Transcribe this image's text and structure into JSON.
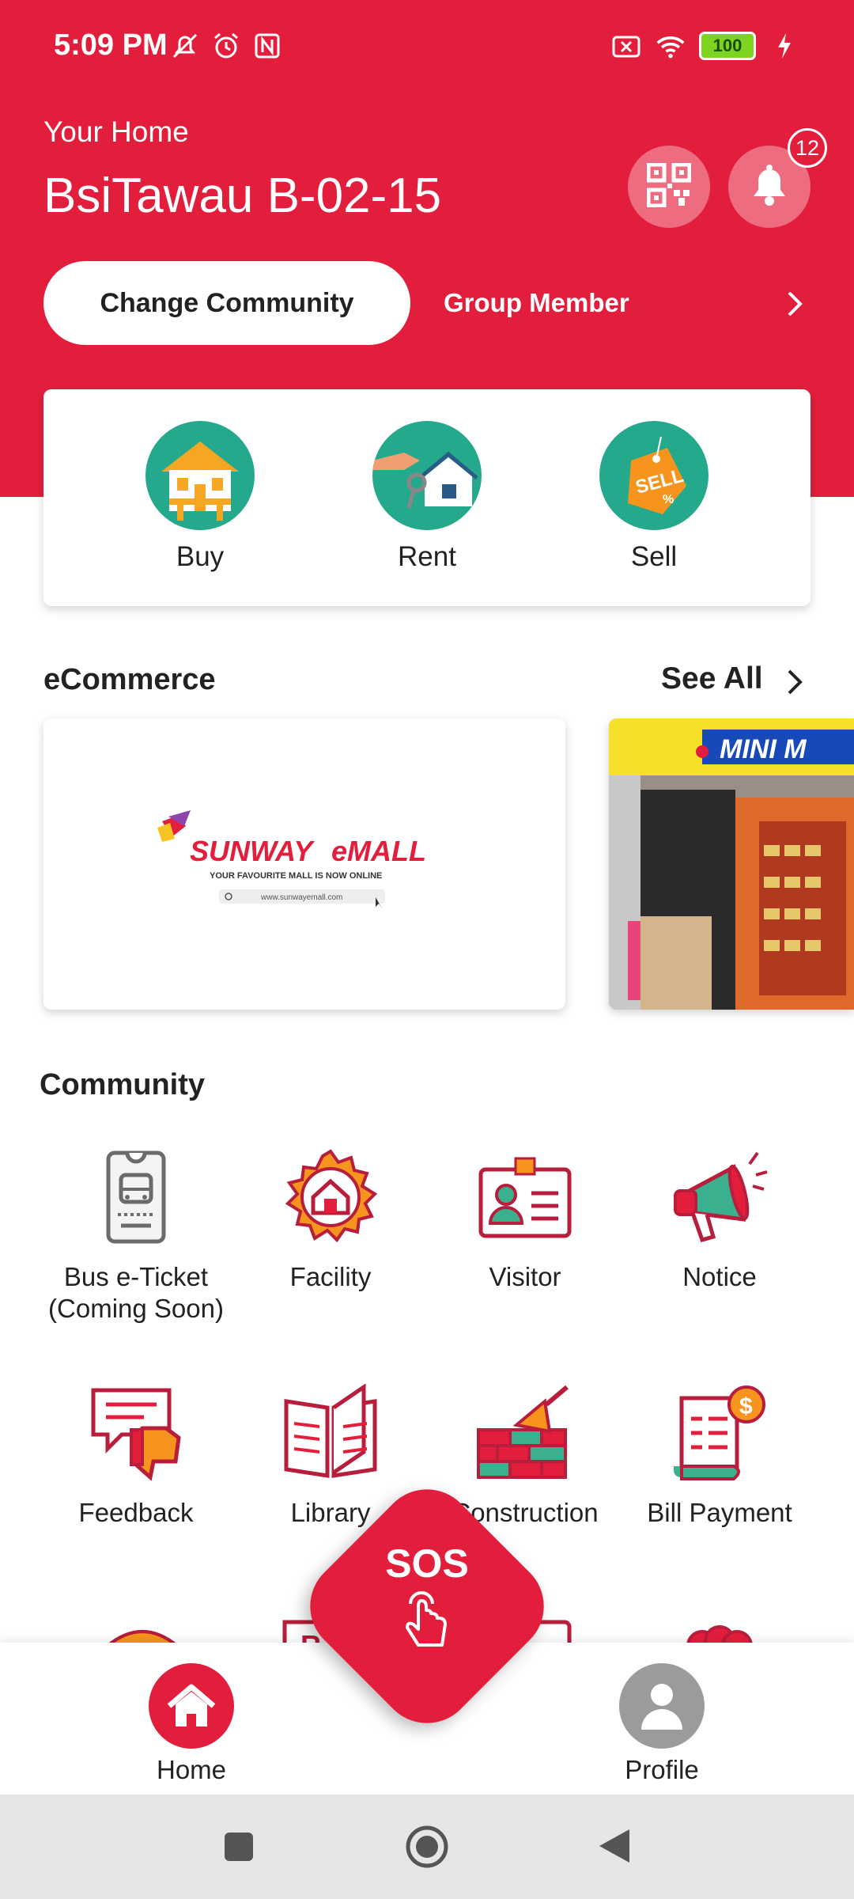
{
  "status_bar": {
    "time": "5:09 PM",
    "battery": "100"
  },
  "header": {
    "subtitle": "Your Home",
    "unit": "BsiTawau B-02-15",
    "notification_count": "12",
    "change_community_label": "Change Community",
    "group_member_label": "Group Member"
  },
  "property_actions": [
    {
      "label": "Buy"
    },
    {
      "label": "Rent"
    },
    {
      "label": "Sell"
    }
  ],
  "ecommerce": {
    "title": "eCommerce",
    "see_all": "See All",
    "banner1": {
      "brand": "SUNWAY",
      "brand2": "eMALL",
      "tagline": "YOUR FAVOURITE MALL IS NOW ONLINE",
      "url": "www.sunwayemall.com"
    },
    "banner2": {
      "sign": "MINI M"
    }
  },
  "community": {
    "title": "Community",
    "items": [
      {
        "label": "Bus e-Ticket\n(Coming Soon)",
        "line1": "Bus e-Ticket",
        "line2": "(Coming Soon)"
      },
      {
        "label": "Facility"
      },
      {
        "label": "Visitor"
      },
      {
        "label": "Notice"
      },
      {
        "label": "Feedback"
      },
      {
        "label": "Library"
      },
      {
        "label": "Construction"
      },
      {
        "label": "Bill Payment"
      }
    ]
  },
  "sos": {
    "label": "SOS"
  },
  "bottom_nav": {
    "home": "Home",
    "profile": "Profile"
  },
  "colors": {
    "brand_red": "#e31e3c",
    "teal": "#25a98c",
    "grey_nav": "#9b9b9b"
  }
}
